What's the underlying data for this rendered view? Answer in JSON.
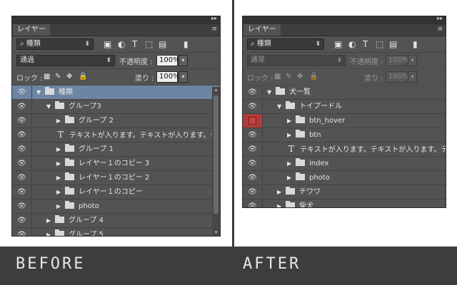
{
  "panels": [
    {
      "tab": "レイヤー",
      "filter_kind": "種類",
      "blend_mode": "通過",
      "opacity_label": "不透明度 :",
      "opacity_value": "100%",
      "lock_label": "ロック :",
      "fill_label": "塗り :",
      "fill_value": "100%",
      "layers": [
        {
          "type": "group",
          "expanded": true,
          "indent": 0,
          "label": "種類",
          "selected": true,
          "eye": "👁"
        },
        {
          "type": "group",
          "expanded": true,
          "indent": 1,
          "label": "グループ3",
          "eye": "👁"
        },
        {
          "type": "group",
          "expanded": false,
          "indent": 2,
          "label": "グループ 2",
          "eye": "👁"
        },
        {
          "type": "text",
          "indent": 2,
          "label": "テキストが入ります。テキストが入ります。テ...",
          "eye": "👁"
        },
        {
          "type": "group",
          "expanded": false,
          "indent": 2,
          "label": "グループ 1",
          "eye": "👁"
        },
        {
          "type": "group",
          "expanded": false,
          "indent": 2,
          "label": "レイヤー１のコピー 3",
          "eye": "👁"
        },
        {
          "type": "group",
          "expanded": false,
          "indent": 2,
          "label": "レイヤー１のコピー 2",
          "eye": "👁"
        },
        {
          "type": "group",
          "expanded": false,
          "indent": 2,
          "label": "レイヤー１のコピー",
          "eye": "👁"
        },
        {
          "type": "group",
          "expanded": false,
          "indent": 2,
          "label": "photo",
          "eye": "👁"
        },
        {
          "type": "group",
          "expanded": false,
          "indent": 1,
          "label": "グループ 4",
          "eye": "👁"
        },
        {
          "type": "group",
          "expanded": false,
          "indent": 1,
          "label": "グループ 5",
          "eye": "👁"
        }
      ]
    },
    {
      "tab": "レイヤー",
      "filter_kind": "種類",
      "blend_mode": "通常",
      "opacity_label": "不透明度 :",
      "opacity_value": "100%",
      "lock_label": "ロック :",
      "fill_label": "塗り :",
      "fill_value": "100%",
      "layers": [
        {
          "type": "group",
          "expanded": true,
          "indent": 0,
          "label": "犬一覧",
          "eye": "👁"
        },
        {
          "type": "group",
          "expanded": true,
          "indent": 1,
          "label": "トイプードル",
          "eye": "👁"
        },
        {
          "type": "group",
          "expanded": false,
          "indent": 2,
          "label": "btn_hover",
          "eye": "",
          "red": true
        },
        {
          "type": "group",
          "expanded": false,
          "indent": 2,
          "label": "btn",
          "eye": "👁"
        },
        {
          "type": "text",
          "indent": 2,
          "label": "テキストが入ります。テキストが入ります。テ...",
          "eye": "👁"
        },
        {
          "type": "group",
          "expanded": false,
          "indent": 2,
          "label": "index",
          "eye": "👁"
        },
        {
          "type": "group",
          "expanded": false,
          "indent": 2,
          "label": "photo",
          "eye": "👁"
        },
        {
          "type": "group",
          "expanded": false,
          "indent": 1,
          "label": "チワワ",
          "eye": "👁"
        },
        {
          "type": "group",
          "expanded": false,
          "indent": 1,
          "label": "柴犬",
          "eye": "👁"
        }
      ]
    }
  ],
  "footer": {
    "before": "BEFORE",
    "after": "AFTER"
  },
  "icons": {
    "panel_menu": "≡",
    "double_arrow": "▸▸",
    "search": "⌕",
    "dropdown": "▾",
    "scroll_up": "▴",
    "scroll_down": "▾"
  },
  "colors": {
    "selected_row": "#6d85a3",
    "hidden_eye": "#b13c3c",
    "panel_bg": "#535353"
  }
}
